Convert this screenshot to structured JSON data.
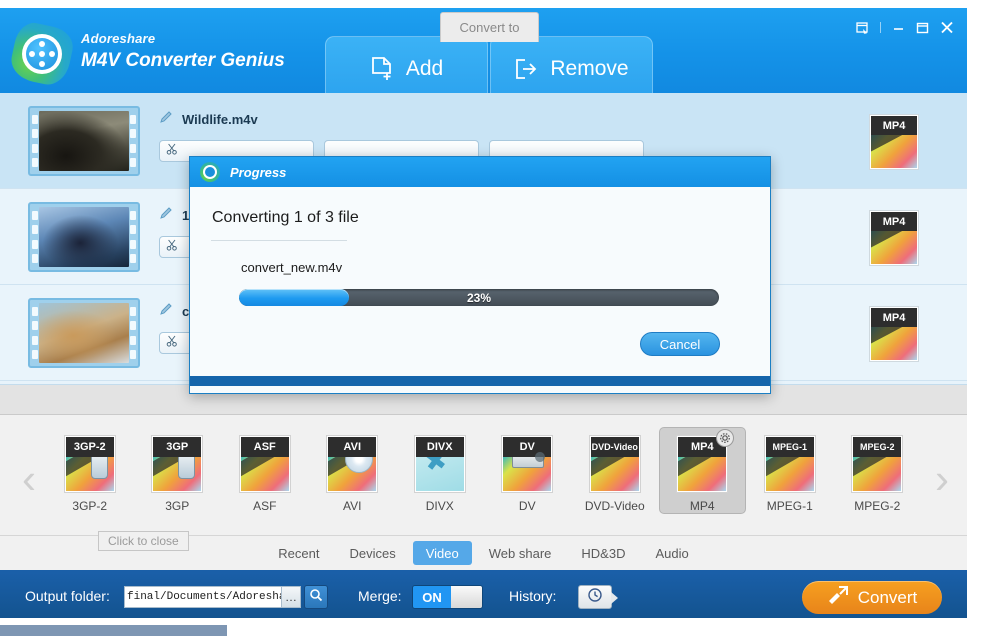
{
  "window": {
    "controls": [
      {
        "name": "skin-icon",
        "label": "Skin"
      },
      {
        "name": "minimize-icon",
        "label": "Minimize"
      },
      {
        "name": "maximize-icon",
        "label": "Maximize"
      },
      {
        "name": "close-icon",
        "label": "Close"
      }
    ]
  },
  "header": {
    "brand_small": "Adoreshare",
    "brand_big": "M4V Converter Genius",
    "add_label": "Add",
    "remove_label": "Remove"
  },
  "files": [
    {
      "name": "Wildlife.m4v",
      "format": "MP4",
      "selected": true
    },
    {
      "name": "1",
      "format": "MP4",
      "selected": false
    },
    {
      "name": "c",
      "format": "MP4",
      "selected": false
    }
  ],
  "convert_panel": {
    "tab_label": "Convert to",
    "tooltip": "Click to close",
    "arrow_left": "‹",
    "arrow_right": "›",
    "formats": [
      {
        "tag": "3GP-2",
        "label": "3GP-2",
        "art": "phone",
        "selected": false
      },
      {
        "tag": "3GP",
        "label": "3GP",
        "art": "phone",
        "selected": false
      },
      {
        "tag": "ASF",
        "label": "ASF",
        "art": "film",
        "selected": false
      },
      {
        "tag": "AVI",
        "label": "AVI",
        "art": "disc",
        "selected": false
      },
      {
        "tag": "DIVX",
        "label": "DIVX",
        "art": "divx",
        "selected": false
      },
      {
        "tag": "DV",
        "label": "DV",
        "art": "cam",
        "selected": false
      },
      {
        "tag": "DVD-Video",
        "label": "DVD-Video",
        "art": "film",
        "selected": false
      },
      {
        "tag": "MP4",
        "label": "MP4",
        "art": "film",
        "selected": true
      },
      {
        "tag": "MPEG-1",
        "label": "MPEG-1",
        "art": "film",
        "selected": false
      },
      {
        "tag": "MPEG-2",
        "label": "MPEG-2",
        "art": "film",
        "selected": false
      }
    ],
    "categories": [
      {
        "label": "Recent",
        "active": false
      },
      {
        "label": "Devices",
        "active": false
      },
      {
        "label": "Video",
        "active": true
      },
      {
        "label": "Web share",
        "active": false
      },
      {
        "label": "HD&3D",
        "active": false
      },
      {
        "label": "Audio",
        "active": false
      }
    ]
  },
  "bottom_bar": {
    "output_label": "Output folder:",
    "output_path": "final/Documents/Adoreshare",
    "browse_label": "…",
    "merge_label": "Merge:",
    "merge_state": "ON",
    "history_label": "History:",
    "convert_label": "Convert"
  },
  "dialog": {
    "title": "Progress",
    "heading": "Converting 1 of 3 file",
    "filename": "convert_new.m4v",
    "percent": 23,
    "percent_label": "23%",
    "cancel_label": "Cancel"
  },
  "colors": {
    "header_blue": "#1492e8",
    "bottom_blue": "#13538f",
    "accent_orange": "#e8841a",
    "progress_blue": "#1e9af0",
    "tab_active": "#55a8e8"
  }
}
